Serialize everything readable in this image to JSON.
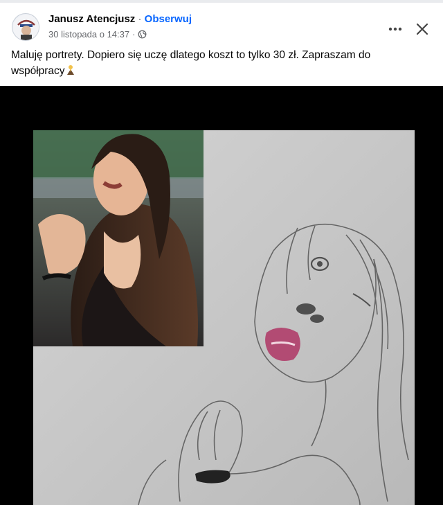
{
  "post": {
    "author": "Janusz Atencjusz",
    "separator": "·",
    "follow_label": "Obserwuj",
    "timestamp": "30 listopada o 14:37",
    "meta_separator": "·",
    "privacy_icon": "globe-icon",
    "more_icon": "more-horizontal-icon",
    "close_icon": "close-icon",
    "text": "Maluję portrety. Dopiero się uczę dlatego koszt to tylko 30 zł. Zapraszam do współpracy",
    "emoji_icon": "praying-person-emoji-icon",
    "image_icon": "photo-comparison-icon"
  },
  "colors": {
    "link": "#0866ff",
    "secondary_text": "#65676b",
    "text": "#050505",
    "media_background": "#000000",
    "sketch_paper": "#c9c9c9"
  }
}
